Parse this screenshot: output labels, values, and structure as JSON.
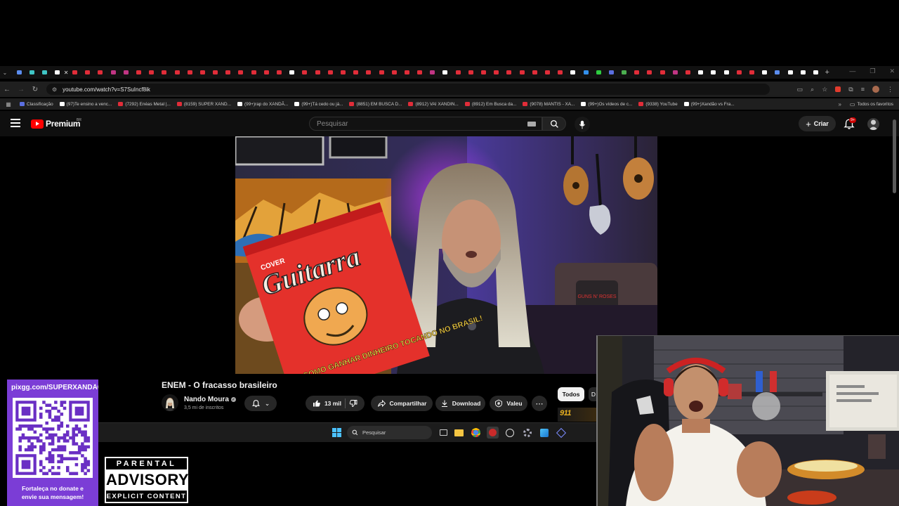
{
  "browser": {
    "url": "youtube.com/watch?v=S7SuIncf8ik",
    "tab_favicon_colors": [
      "#5b8def",
      "#3fc5c5",
      "#3fc5c5",
      "#ffffff",
      "#e12d39",
      "#e12d39",
      "#e12d39",
      "#c13584",
      "#c13584",
      "#e12d39",
      "#e12d39",
      "#e12d39",
      "#e12d39",
      "#e12d39",
      "#e12d39",
      "#e12d39",
      "#e12d39",
      "#e12d39",
      "#e12d39",
      "#e12d39",
      "#e12d39",
      "#ffffff",
      "#e12d39",
      "#e12d39",
      "#e12d39",
      "#e12d39",
      "#e12d39",
      "#e12d39",
      "#e12d39",
      "#e12d39",
      "#e12d39",
      "#e12d39",
      "#c13584",
      "#ffffff",
      "#e12d39",
      "#e12d39",
      "#e12d39",
      "#e12d39",
      "#e12d39",
      "#e12d39",
      "#e12d39",
      "#e12d39",
      "#e12d39",
      "#ffffff",
      "#3390ec",
      "#2ecc40",
      "#5b6fe0",
      "#4caf50",
      "#e12d39",
      "#e12d39",
      "#e12d39",
      "#c13584",
      "#e12d39",
      "#ffffff",
      "#ffffff",
      "#ffffff",
      "#e12d39",
      "#e12d39",
      "#ffffff",
      "#5b8def",
      "#ffffff",
      "#ffffff",
      "#ffffff"
    ],
    "bookmarks": [
      {
        "label": "Classificação",
        "color": "#5b6fe0"
      },
      {
        "label": "(97)Te ensino a venc...",
        "color": "#ffffff"
      },
      {
        "label": "(7292) Enéas Metal |...",
        "color": "#e12d39"
      },
      {
        "label": "(8159) SUPER XAND...",
        "color": "#e12d39"
      },
      {
        "label": "(99+)rap do XANDÃ...",
        "color": "#ffffff"
      },
      {
        "label": "(99+)Tá cedo ou já...",
        "color": "#ffffff"
      },
      {
        "label": "(8851) EM BUSCA D...",
        "color": "#e12d39"
      },
      {
        "label": "(8912) VAI XANDIN...",
        "color": "#e12d39"
      },
      {
        "label": "(8912) Em Busca da...",
        "color": "#e12d39"
      },
      {
        "label": "(9078) MANTIS - XA...",
        "color": "#e12d39"
      },
      {
        "label": "(99+)Os vídeos de c...",
        "color": "#ffffff"
      },
      {
        "label": "(9338) YouTube",
        "color": "#e12d39"
      },
      {
        "label": "(99+)Xandão vs Fra...",
        "color": "#ffffff"
      }
    ],
    "all_bookmarks_label": "Todos os favoritos"
  },
  "youtube": {
    "brand": "Premium",
    "region": "BR",
    "search_placeholder": "Pesquisar",
    "create_label": "Criar",
    "notification_badge": "9+",
    "video": {
      "title": "ENEM - O fracasso brasileiro",
      "channel": "Nando Moura",
      "verified_mark": "✓",
      "subscribers": "3,5 mi de inscritos",
      "likes": "13 mil",
      "share_label": "Compartilhar",
      "download_label": "Download",
      "thanks_label": "Valeu",
      "magazine_brand": "Guitarra",
      "magazine_cover_word": "COVER",
      "magazine_headline": "COMO GANHAR DINHEIRO TOCANDO NO BRASIL!"
    },
    "chips": {
      "active": "Todos",
      "next": "D"
    },
    "reco_thumb_text": "911"
  },
  "taskbar": {
    "search_label": "Pesquisar"
  },
  "overlay": {
    "donation_url": "pixgg.com/SUPERXANDÃO",
    "donation_caption_line1": "Fortaleça no donate e",
    "donation_caption_line2": "envie sua mensagem!",
    "advisory_top": "PARENTAL",
    "advisory_mid": "ADVISORY",
    "advisory_bottom": "EXPLICIT CONTENT"
  }
}
